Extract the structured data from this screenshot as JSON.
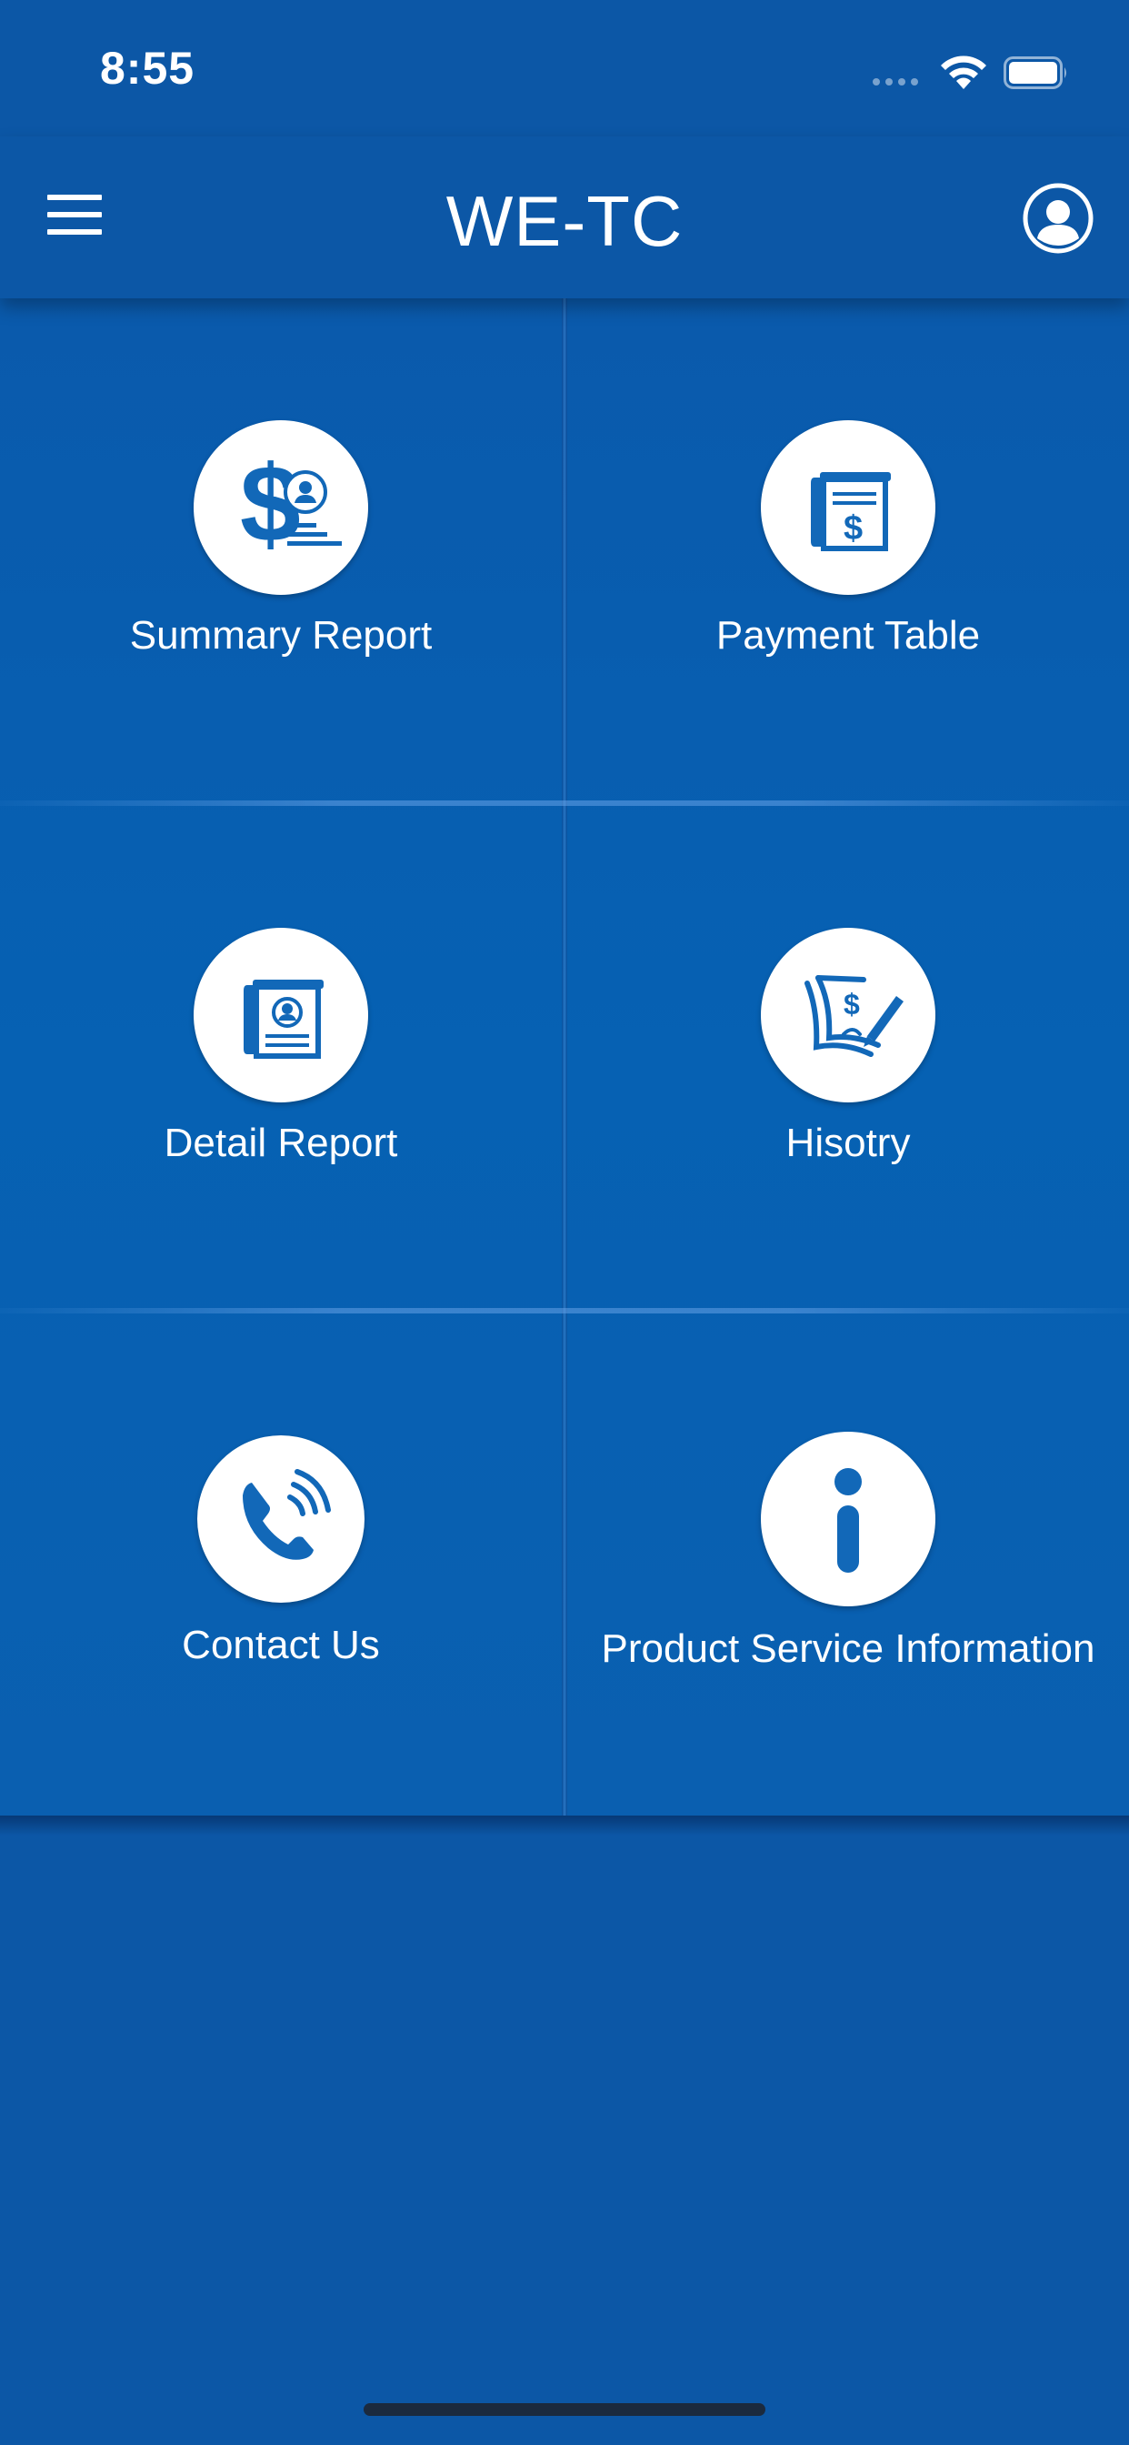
{
  "status_bar": {
    "time": "8:55"
  },
  "header": {
    "title": "WE-TC",
    "menu_icon": "hamburger-menu-icon",
    "profile_icon": "user-profile-icon"
  },
  "menu": {
    "items": [
      {
        "label": "Summary Report",
        "icon": "dollar-person-report-icon"
      },
      {
        "label": "Payment Table",
        "icon": "payment-document-icon"
      },
      {
        "label": "Detail Report",
        "icon": "person-document-icon"
      },
      {
        "label": "Hisotry",
        "icon": "signed-check-icon"
      },
      {
        "label": "Contact Us",
        "icon": "phone-ringing-icon"
      },
      {
        "label": "Product Service Information",
        "icon": "info-icon"
      }
    ]
  },
  "colors": {
    "background": "#0c57a6",
    "icon_blue": "#1268b8",
    "icon_circle": "#ffffff"
  }
}
